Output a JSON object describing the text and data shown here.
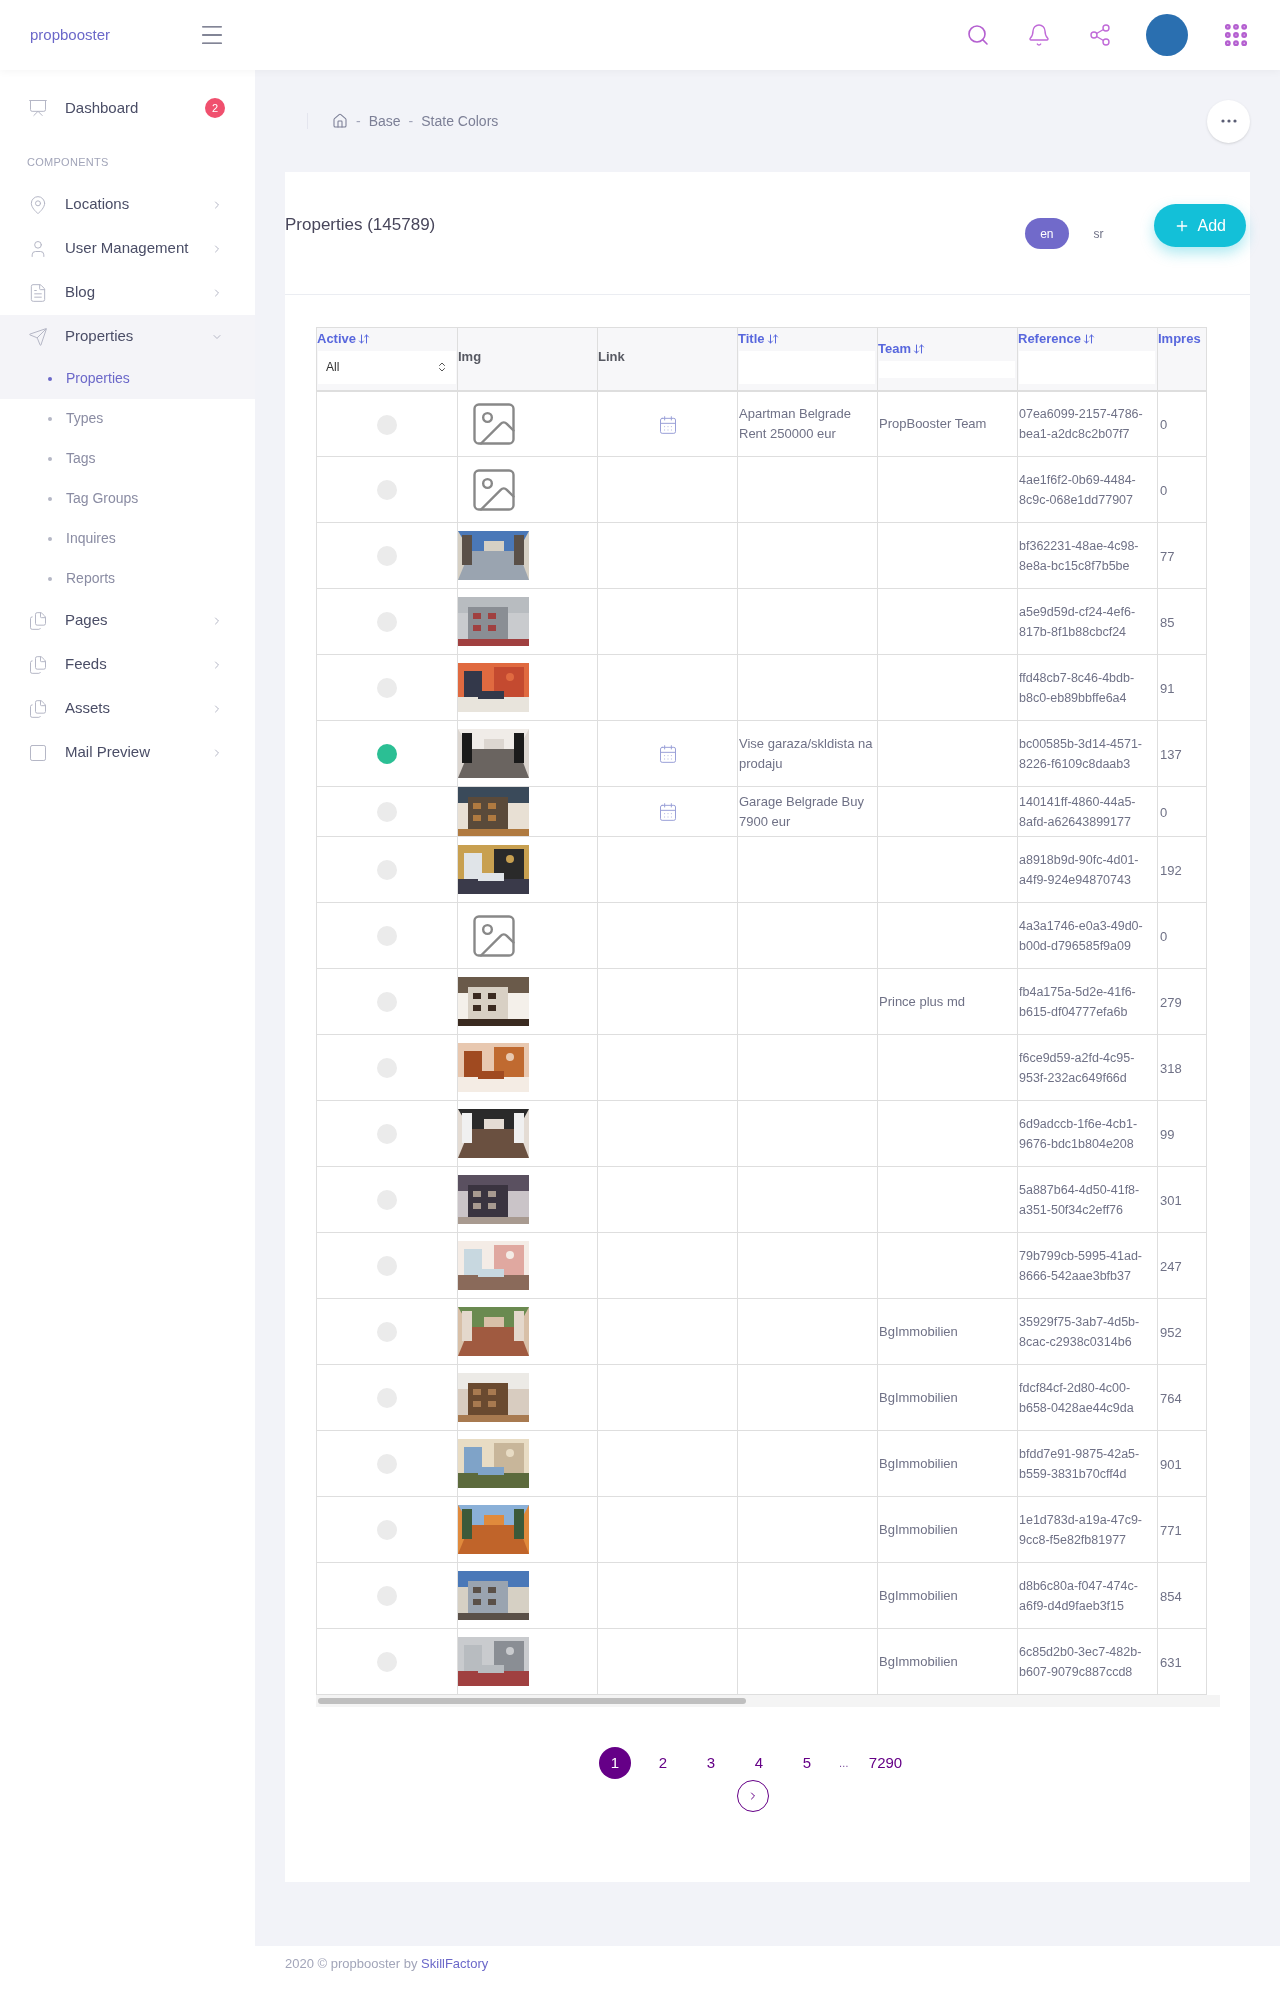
{
  "brand": "propbooster",
  "sidebar": {
    "items": [
      {
        "kind": "item",
        "label": "Dashboard",
        "badge": "2"
      },
      {
        "kind": "section",
        "label": "COMPONENTS"
      },
      {
        "kind": "item",
        "label": "Locations",
        "expanded": false
      },
      {
        "kind": "item",
        "label": "User Management",
        "expanded": false
      },
      {
        "kind": "item",
        "label": "Blog",
        "expanded": false
      },
      {
        "kind": "item",
        "label": "Properties",
        "expanded": true,
        "children": [
          {
            "label": "Properties",
            "selected": true
          },
          {
            "label": "Types",
            "selected": false
          },
          {
            "label": "Tags",
            "selected": false
          },
          {
            "label": "Tag Groups",
            "selected": false
          },
          {
            "label": "Inquires",
            "selected": false
          },
          {
            "label": "Reports",
            "selected": false
          }
        ]
      },
      {
        "kind": "item",
        "label": "Pages",
        "expanded": false
      },
      {
        "kind": "item",
        "label": "Feeds",
        "expanded": false
      },
      {
        "kind": "item",
        "label": "Assets",
        "expanded": false
      },
      {
        "kind": "item",
        "label": "Mail Preview",
        "expanded": false
      }
    ]
  },
  "breadcrumb": [
    {
      "separator": "-",
      "label": "Base"
    },
    {
      "separator": "-",
      "label": "State Colors"
    }
  ],
  "card": {
    "title": "Properties (145789)",
    "languages": [
      {
        "label": "en",
        "selected": true
      },
      {
        "label": "sr",
        "selected": false
      }
    ],
    "add_button": "Add"
  },
  "table": {
    "columns": [
      {
        "kind": "select",
        "label": "Active",
        "sortable": true,
        "value": "All"
      },
      {
        "kind": "plain",
        "label": "Img",
        "sortable": false
      },
      {
        "kind": "plain",
        "label": "Link",
        "sortable": false
      },
      {
        "kind": "input",
        "label": "Title",
        "sortable": true
      },
      {
        "kind": "input",
        "label": "Team",
        "sortable": true
      },
      {
        "kind": "input",
        "label": "Reference",
        "sortable": true
      },
      {
        "kind": "cut",
        "label": "Impres"
      }
    ],
    "rows": [
      {
        "kind": "placeholder",
        "active": false,
        "link": true,
        "title": "Apartman Belgrade Rent 250000 eur",
        "team": "PropBooster Team",
        "reference": "07ea6099-2157-4786-bea1-a2dc8c2b07f7",
        "impressions": "0"
      },
      {
        "kind": "placeholder",
        "active": false,
        "link": false,
        "reference": "4ae1f6f2-0b69-4484-8c9c-068e1dd77907",
        "impressions": "0"
      },
      {
        "kind": "picture",
        "active": false,
        "link": false,
        "reference": "bf362231-48ae-4c98-8e8a-bc15c8f7b5be",
        "impressions": "77"
      },
      {
        "kind": "picture",
        "active": false,
        "link": false,
        "reference": "a5e9d59d-cf24-4ef6-817b-8f1b88cbcf24",
        "impressions": "85"
      },
      {
        "kind": "picture",
        "active": false,
        "link": false,
        "reference": "ffd48cb7-8c46-4bdb-b8c0-eb89bbffe6a4",
        "impressions": "91"
      },
      {
        "kind": "picture",
        "active": true,
        "link": true,
        "title": "Vise garaza/skldista na prodaju",
        "reference": "bc00585b-3d14-4571-8226-f6109c8daab3",
        "impressions": "137"
      },
      {
        "kind": "picture",
        "active": false,
        "link": true,
        "title": "Garage Belgrade Buy 7900 eur",
        "reference": "140141ff-4860-44a5-8afd-a62643899177",
        "impressions": "0"
      },
      {
        "kind": "picture",
        "active": false,
        "link": false,
        "reference": "a8918b9d-90fc-4d01-a4f9-924e94870743",
        "impressions": "192"
      },
      {
        "kind": "placeholder",
        "active": false,
        "link": false,
        "reference": "4a3a1746-e0a3-49d0-b00d-d796585f9a09",
        "impressions": "0"
      },
      {
        "kind": "picture",
        "active": false,
        "link": false,
        "team": "Prince plus md",
        "reference": "fb4a175a-5d2e-41f6-b615-df04777efa6b",
        "impressions": "279"
      },
      {
        "kind": "picture",
        "active": false,
        "link": false,
        "reference": "f6ce9d59-a2fd-4c95-953f-232ac649f66d",
        "impressions": "318"
      },
      {
        "kind": "picture",
        "active": false,
        "link": false,
        "reference": "6d9adccb-1f6e-4cb1-9676-bdc1b804e208",
        "impressions": "99"
      },
      {
        "kind": "picture",
        "active": false,
        "link": false,
        "reference": "5a887b64-4d50-41f8-a351-50f34c2eff76",
        "impressions": "301"
      },
      {
        "kind": "picture",
        "active": false,
        "link": false,
        "reference": "79b799cb-5995-41ad-8666-542aae3bfb37",
        "impressions": "247"
      },
      {
        "kind": "picture",
        "active": false,
        "link": false,
        "team": "BgImmobilien",
        "reference": "35929f75-3ab7-4d5b-8cac-c2938c0314b6",
        "impressions": "952"
      },
      {
        "kind": "picture",
        "active": false,
        "link": false,
        "team": "BgImmobilien",
        "reference": "fdcf84cf-2d80-4c00-b658-0428ae44c9da",
        "impressions": "764"
      },
      {
        "kind": "picture",
        "active": false,
        "link": false,
        "team": "BgImmobilien",
        "reference": "bfdd7e91-9875-42a5-b559-3831b70cff4d",
        "impressions": "901"
      },
      {
        "kind": "picture",
        "active": false,
        "link": false,
        "team": "BgImmobilien",
        "reference": "1e1d783d-a19a-47c9-9cc8-f5e82fb81977",
        "impressions": "771"
      },
      {
        "kind": "picture",
        "active": false,
        "link": false,
        "team": "BgImmobilien",
        "reference": "d8b6c80a-f047-474c-a6f9-d4d9faeb3f15",
        "impressions": "854"
      },
      {
        "kind": "picture",
        "active": false,
        "link": false,
        "team": "BgImmobilien",
        "reference": "6c85d2b0-3ec7-482b-b607-9079c887ccd8",
        "impressions": "631"
      }
    ]
  },
  "pagination": {
    "pages": [
      {
        "kind": "page",
        "label": "1",
        "selected": true
      },
      {
        "kind": "page",
        "label": "2",
        "selected": false
      },
      {
        "kind": "page",
        "label": "3",
        "selected": false
      },
      {
        "kind": "page",
        "label": "4",
        "selected": false
      },
      {
        "kind": "page",
        "label": "5",
        "selected": false
      },
      {
        "kind": "ellipsis",
        "label": "…"
      },
      {
        "kind": "page",
        "label": "7290",
        "selected": false
      }
    ]
  },
  "footer": {
    "text": "2020 © propbooster by",
    "link": "SkillFactory"
  }
}
